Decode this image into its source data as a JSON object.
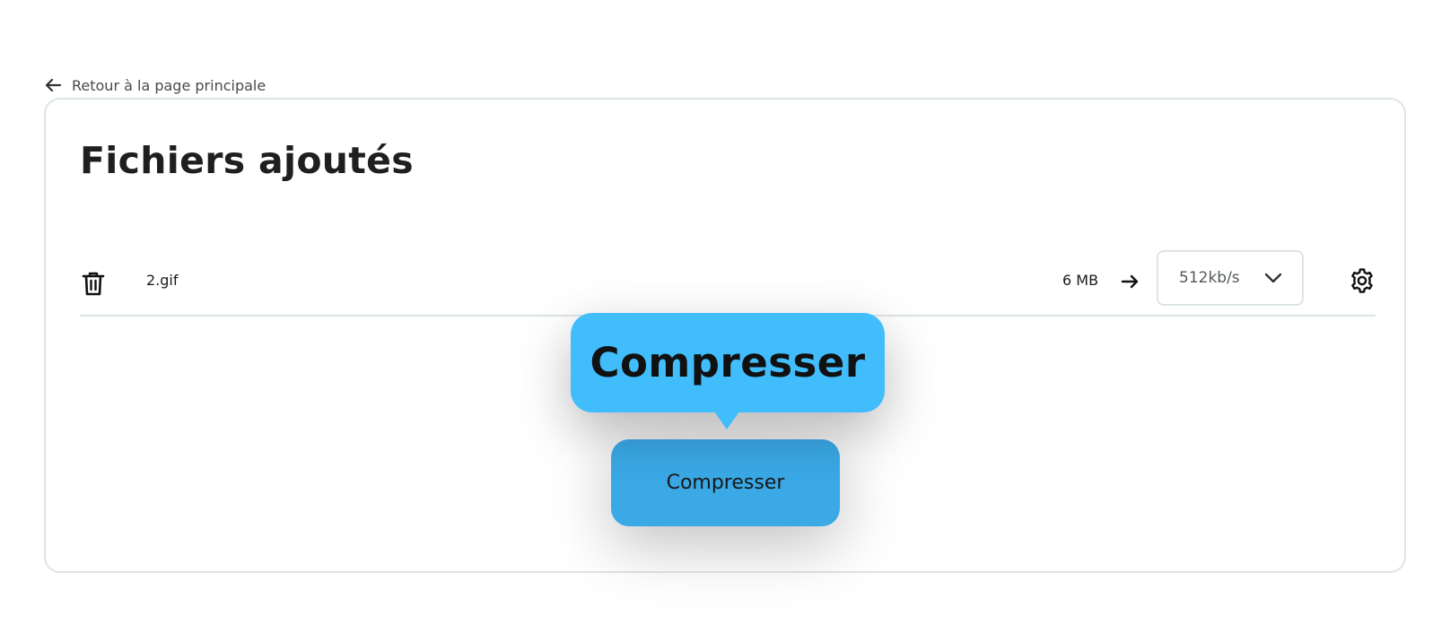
{
  "nav": {
    "back_label": "Retour à la page principale",
    "back_icon": "arrow-left-icon"
  },
  "page": {
    "title": "Fichiers ajoutés"
  },
  "files": [
    {
      "name": "2.gif",
      "size": "6 MB",
      "bitrate_selected": "512kb/s",
      "icons": {
        "delete": "trash-icon",
        "arrow": "arrow-right-icon",
        "dropdown": "chevron-down-icon",
        "settings": "gear-icon"
      }
    }
  ],
  "tooltip": {
    "text": "Compresser"
  },
  "actions": {
    "compress_label": "Compresser"
  },
  "colors": {
    "accent": "#42bdfb",
    "button": "#3aa9e6",
    "border": "#dde4e8"
  }
}
